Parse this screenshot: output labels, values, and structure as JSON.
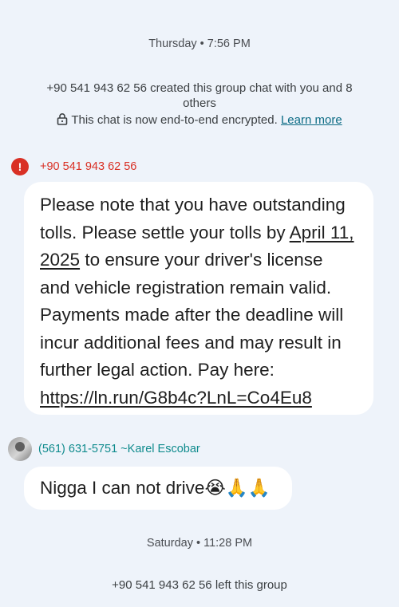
{
  "timestamps": {
    "first": "Thursday • 7:56 PM",
    "second": "Saturday • 11:28 PM"
  },
  "system": {
    "created": "+90 541 943 62 56 created this group chat with you and 8 others",
    "encryption": "This chat is now end-to-end encrypted.",
    "learn_more": "Learn more",
    "left": "+90 541 943 62 56 left this group"
  },
  "messages": [
    {
      "sender": "+90 541 943 62 56",
      "status_icon": "error-icon",
      "parts": {
        "t1": "Please note that you have outstanding tolls. Please settle your tolls by ",
        "date": "April 11, 2025",
        "t2": " to ensure your driver's license and vehicle registration remain valid. Payments made after the deadline will incur additional fees and may result in further legal action. Pay here: ",
        "link": "https://ln.run/G8b4c?LnL=Co4Eu8"
      }
    },
    {
      "sender": "(561) 631-5751 ~Karel Escobar",
      "avatar_icon": "avatar",
      "text": "Nigga I can not drive😭🙏🙏"
    }
  ],
  "colors": {
    "background": "#eef3fa",
    "bubble": "#ffffff",
    "error_red": "#d93025",
    "sender_teal": "#0f8b8d",
    "link_teal": "#0b6b84"
  }
}
